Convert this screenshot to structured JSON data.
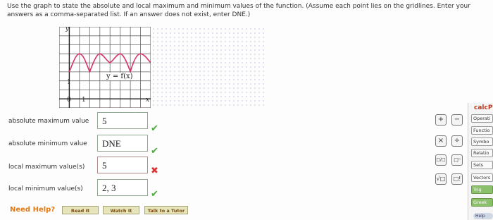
{
  "instructions": "Use the graph to state the absolute and local maximum and minimum values of the function. (Assume each point lies on the gridlines. Enter your answers as a comma-separated list. If an answer does not exist, enter DNE.)",
  "graph": {
    "function_label": "y = f(x)",
    "y_axis_label": "y",
    "x_axis_label": "x",
    "tick_y": "1",
    "tick_x": "1",
    "origin": "0"
  },
  "answers": [
    {
      "label": "absolute maximum value",
      "value": "5",
      "status": "correct"
    },
    {
      "label": "absolute minimum value",
      "value": "DNE",
      "status": "correct"
    },
    {
      "label": "local maximum value(s)",
      "value": "5",
      "status": "incorrect"
    },
    {
      "label": "local minimum value(s)",
      "value": "2, 3",
      "status": "correct"
    }
  ],
  "help": {
    "need_help": "Need Help?",
    "read_it": "Read It",
    "watch_it": "Watch It",
    "talk_to_tutor": "Talk to a Tutor"
  },
  "palette": {
    "plus": "+",
    "minus": "−",
    "times": "×",
    "divide": "÷",
    "fraction": "□/□",
    "power": "□ⁿ",
    "sqrt": "√□",
    "factorial": "□!"
  },
  "calcpad": {
    "title": "calcP",
    "items": [
      "Operati",
      "Functio",
      "Symbo",
      "Relatio",
      "Sets",
      "Vectors",
      "Trig",
      "Greek"
    ],
    "help": "Help"
  },
  "colors": {
    "curve": "#d6336c",
    "check": "#4daa3d",
    "cross": "#dd3333",
    "need_help": "#e07a15"
  }
}
